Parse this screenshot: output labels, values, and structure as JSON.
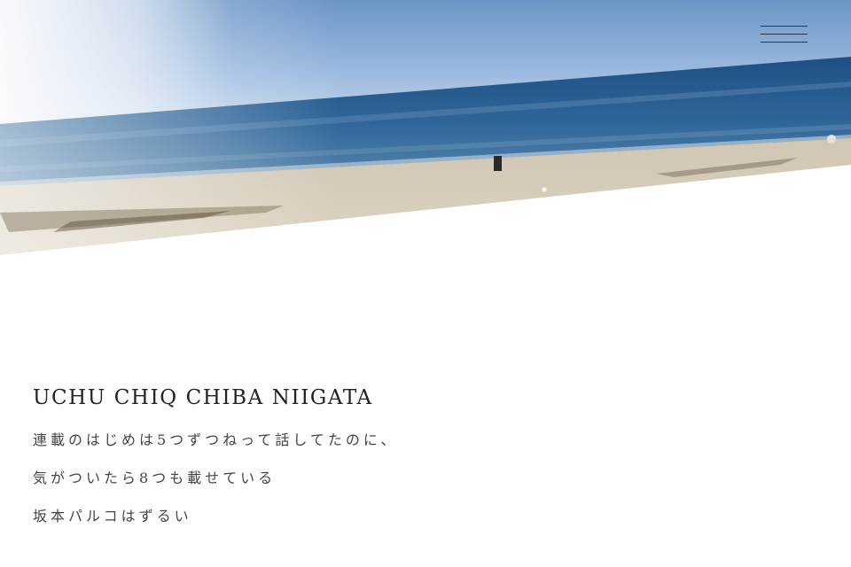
{
  "header": {
    "menu_icon": "hamburger-menu-icon",
    "hero_image": "beach-sea-photo"
  },
  "main": {
    "title": "UCHU CHIQ CHIBA NIIGATA",
    "lines": [
      "連載のはじめは5つずつねって話してたのに、",
      "気がついたら8つも載せている",
      "坂本パルコはずるい"
    ]
  },
  "colors": {
    "text": "#222222",
    "sea": "#2f5f8f",
    "sky": "#a9c4e2",
    "sand": "#d9d0bf"
  }
}
